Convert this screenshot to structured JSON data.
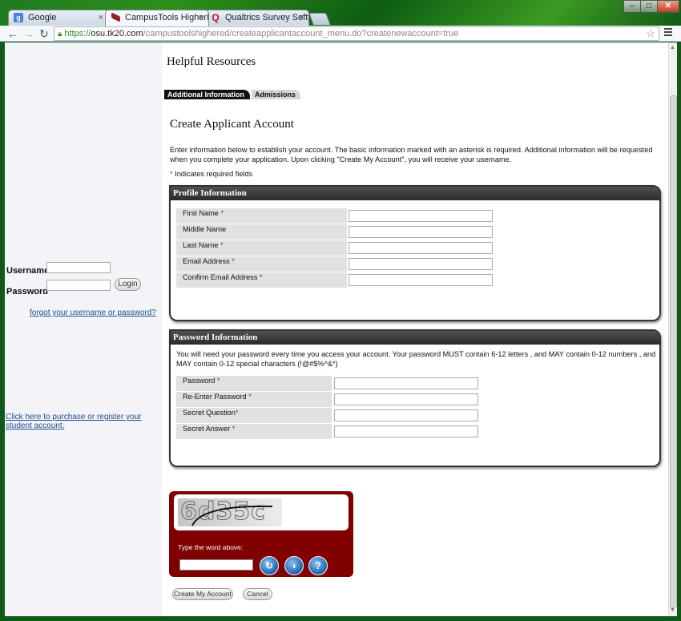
{
  "browser": {
    "tabs": [
      {
        "title": "Google",
        "favicon": "google-icon"
      },
      {
        "title": "CampusTools HigherEd",
        "favicon": "campustools-icon"
      },
      {
        "title": "Qualtrics Survey Software",
        "favicon": "qualtrics-icon"
      }
    ],
    "tab_close": "×",
    "url_scheme": "https://",
    "url_host": "osu.tk20.com",
    "url_path": "/campustoolshighered/createapplicantaccount_menu.do?createnewaccount=true",
    "window_buttons": {
      "minimize": "–",
      "maximize": "□",
      "close": "✕"
    }
  },
  "sidebar": {
    "username_label": "Username",
    "password_label": "Password",
    "login_button": "Login",
    "forgot_link": "forgot your username or password?",
    "purchase_link": "Click here to purchase or register your student account."
  },
  "main": {
    "resources_title": "Helpful Resources",
    "tabs": [
      "Additional Information",
      "Admissions"
    ],
    "heading": "Create Applicant Account",
    "intro": "Enter information below to establish your account. The basic information marked with an asterisk is required. Additional information will be requested when you complete your application. Upon clicking \"Create My Account\", you will receive your username.",
    "required_note": "Indicates required fields",
    "asterisk": "*"
  },
  "profile": {
    "title": "Profile Information",
    "fields": [
      {
        "label": "First Name",
        "required": true
      },
      {
        "label": "Middle Name",
        "required": false
      },
      {
        "label": "Last Name",
        "required": true
      },
      {
        "label": "Email Address",
        "required": true
      },
      {
        "label": "Confirm Email Address",
        "required": true
      }
    ]
  },
  "password": {
    "title": "Password Information",
    "intro": "You will need your password every time you access your account. Your password MUST contain 6-12 letters , and MAY contain 0-12 numbers , and MAY contain 0-12 special characters (!@#$%^&*)",
    "fields": [
      {
        "label": "Password",
        "required": true
      },
      {
        "label": "Re-Enter Password",
        "required": true
      },
      {
        "label": "Secret Question",
        "required": true
      },
      {
        "label": "Secret Answer",
        "required": true
      }
    ]
  },
  "captcha": {
    "image_text": "6d35c",
    "prompt": "Type the word above:",
    "buttons": [
      "refresh-icon",
      "audio-icon",
      "help-icon"
    ]
  },
  "actions": {
    "create": "Create My Account",
    "cancel": "Cancel"
  },
  "colors": {
    "captcha_bg": "#800000",
    "panel_header": "#333333",
    "link": "#1a4e8c",
    "required": "#b01c1c"
  }
}
